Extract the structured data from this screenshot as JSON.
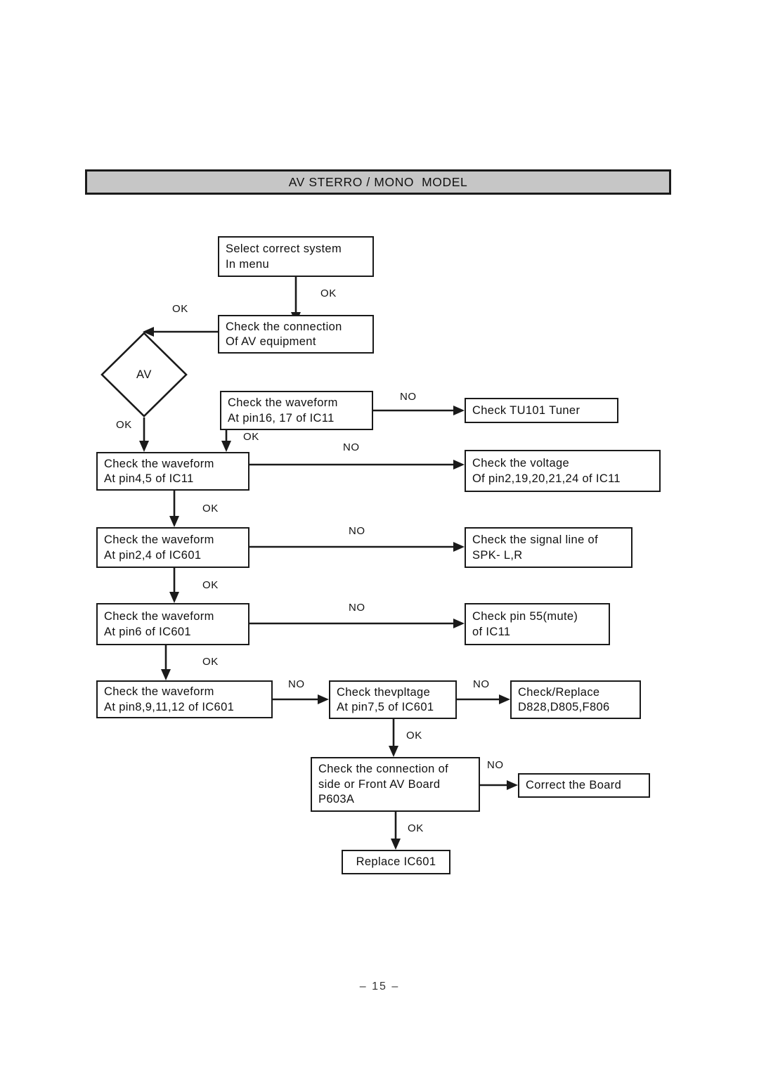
{
  "header": {
    "title": "AV STERRO / MONO  MODEL"
  },
  "footer": {
    "page_number": "– 15 –"
  },
  "nodes": {
    "select_system": {
      "line1": "Select correct system",
      "line2": "In menu"
    },
    "check_av_connection": {
      "line1": "Check the connection",
      "line2": "Of AV equipment"
    },
    "av_decision": {
      "label": "AV"
    },
    "check_wf_pin16_17": {
      "line1": "Check the waveform",
      "line2": "At pin16, 17 of IC11"
    },
    "check_tuner": {
      "line1": "Check TU101 Tuner"
    },
    "check_wf_pin4_5": {
      "line1": "Check the waveform",
      "line2": "At pin4,5 of IC11"
    },
    "check_voltage_ic11": {
      "line1": "Check the voltage",
      "line2": "Of pin2,19,20,21,24 of IC11"
    },
    "check_wf_pin2_4": {
      "line1": "Check the waveform",
      "line2": "At pin2,4 of IC601"
    },
    "check_signal_spk": {
      "line1": "Check the signal line of",
      "line2": "SPK- L,R"
    },
    "check_wf_pin6": {
      "line1": "Check the waveform",
      "line2": "At pin6 of IC601"
    },
    "check_pin55_mute": {
      "line1": "Check pin 55(mute)",
      "line2": "of IC11"
    },
    "check_wf_pin8_9_11_12": {
      "line1": "Check the waveform",
      "line2": "At pin8,9,11,12 of IC601"
    },
    "check_voltage_pin7_5": {
      "line1": "Check thevpltage",
      "line2": "At pin7,5 of IC601"
    },
    "check_replace_diodes": {
      "line1": "Check/Replace",
      "line2": "D828,D805,F806"
    },
    "check_av_board": {
      "line1": "Check the connection of",
      "line2": "side or Front AV Board",
      "line3": "P603A"
    },
    "correct_board": {
      "line1": "Correct the Board"
    },
    "replace_ic601": {
      "line1": "Replace IC601"
    }
  },
  "edge_labels": {
    "ok_select_to_connection": "OK",
    "ok_connection_to_av": "OK",
    "ok_av_to_pin4_5": "OK",
    "no_pin16_to_tuner": "NO",
    "ok_pin16_to_pin4_5": "OK",
    "no_pin4_5_to_voltage": "NO",
    "ok_pin4_5_to_pin2_4": "OK",
    "no_pin2_4_to_spk": "NO",
    "ok_pin2_4_to_pin6": "OK",
    "no_pin6_to_mute": "NO",
    "ok_pin6_to_pin8": "OK",
    "no_pin8_to_voltage": "NO",
    "no_voltage_to_replace": "NO",
    "ok_voltage_to_board": "OK",
    "no_board_to_correct": "NO",
    "ok_board_to_replace_ic": "OK"
  },
  "colors": {
    "banner_fill": "#c6c6c6",
    "stroke": "#1a1a1a",
    "text": "#111111",
    "background": "#ffffff"
  }
}
